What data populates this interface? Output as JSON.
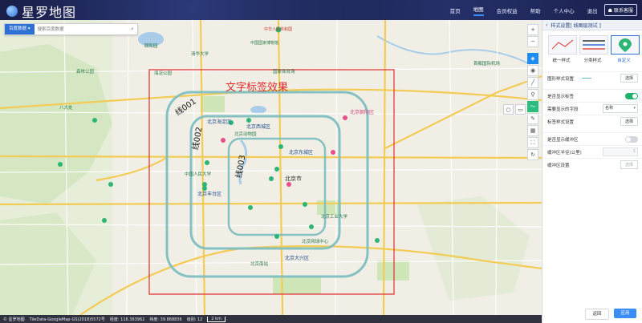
{
  "app": {
    "name": "星罗地图"
  },
  "nav": {
    "items": [
      "首页",
      "地图",
      "会员权益",
      "帮助",
      "个人中心",
      "退出"
    ],
    "active_index": 1,
    "contact": "联系客服"
  },
  "search": {
    "engine": "百度数据",
    "placeholder": "搜索百度数据"
  },
  "map": {
    "annotation": "文字标签效果",
    "line_labels": [
      "线001",
      "线002",
      "线003"
    ],
    "places": [
      "中国国家博物馆",
      "北京海淀区",
      "北京西城区",
      "北京市",
      "北京东城区",
      "北京朝阳区",
      "北京丰台区",
      "北京大兴区",
      "北京网球中心",
      "颐和园",
      "清华大学",
      "北京动物园",
      "中华人民共和国",
      "北京工业大学",
      "海淀公园",
      "中国人民大学",
      "森林公园",
      "八大处",
      "国家体育场",
      "北京南站",
      "首都国际机场"
    ],
    "colors": {
      "red_box": "#e23b3b",
      "line": "#7fbfc2",
      "water": "#a9cde8",
      "green": "#cfe6b8"
    }
  },
  "tools": [
    "plus-icon",
    "minus-icon",
    "layers-icon",
    "eye-icon",
    "ruler-icon",
    "pin-icon",
    "polyline-icon",
    "edit-icon",
    "grid-icon",
    "crop-icon",
    "refresh-icon"
  ],
  "panel": {
    "title": "样式设置[ 线图层测试 ]",
    "styles": [
      {
        "label": "统一样式"
      },
      {
        "label": "分类样式"
      },
      {
        "label": "自定义"
      }
    ],
    "selected_style": 2,
    "rows": {
      "line_style": {
        "label": "图形样式设置",
        "button": "选择"
      },
      "show_label": {
        "label": "是否显示标签",
        "on": true
      },
      "label_field": {
        "label": "需要显示的字段",
        "value": "名称"
      },
      "label_style": {
        "label": "标签样式设置",
        "button": "选择"
      },
      "show_buffer": {
        "label": "是否显示缓冲区",
        "on": false
      },
      "buffer_radius": {
        "label": "缓冲区半径(公里)",
        "value": "1"
      },
      "buffer_style": {
        "label": "缓冲区设置",
        "button": "选择"
      }
    },
    "cancel": "返回",
    "apply": "应用"
  },
  "status": {
    "copyright": "© 星罗地图",
    "source": "TileData-GoogleMap-GS(2018)5572号",
    "lon": "经度: 116.363962",
    "lat": "纬度: 39.868836",
    "zoom": "级别: 12",
    "scale": "2 km"
  }
}
